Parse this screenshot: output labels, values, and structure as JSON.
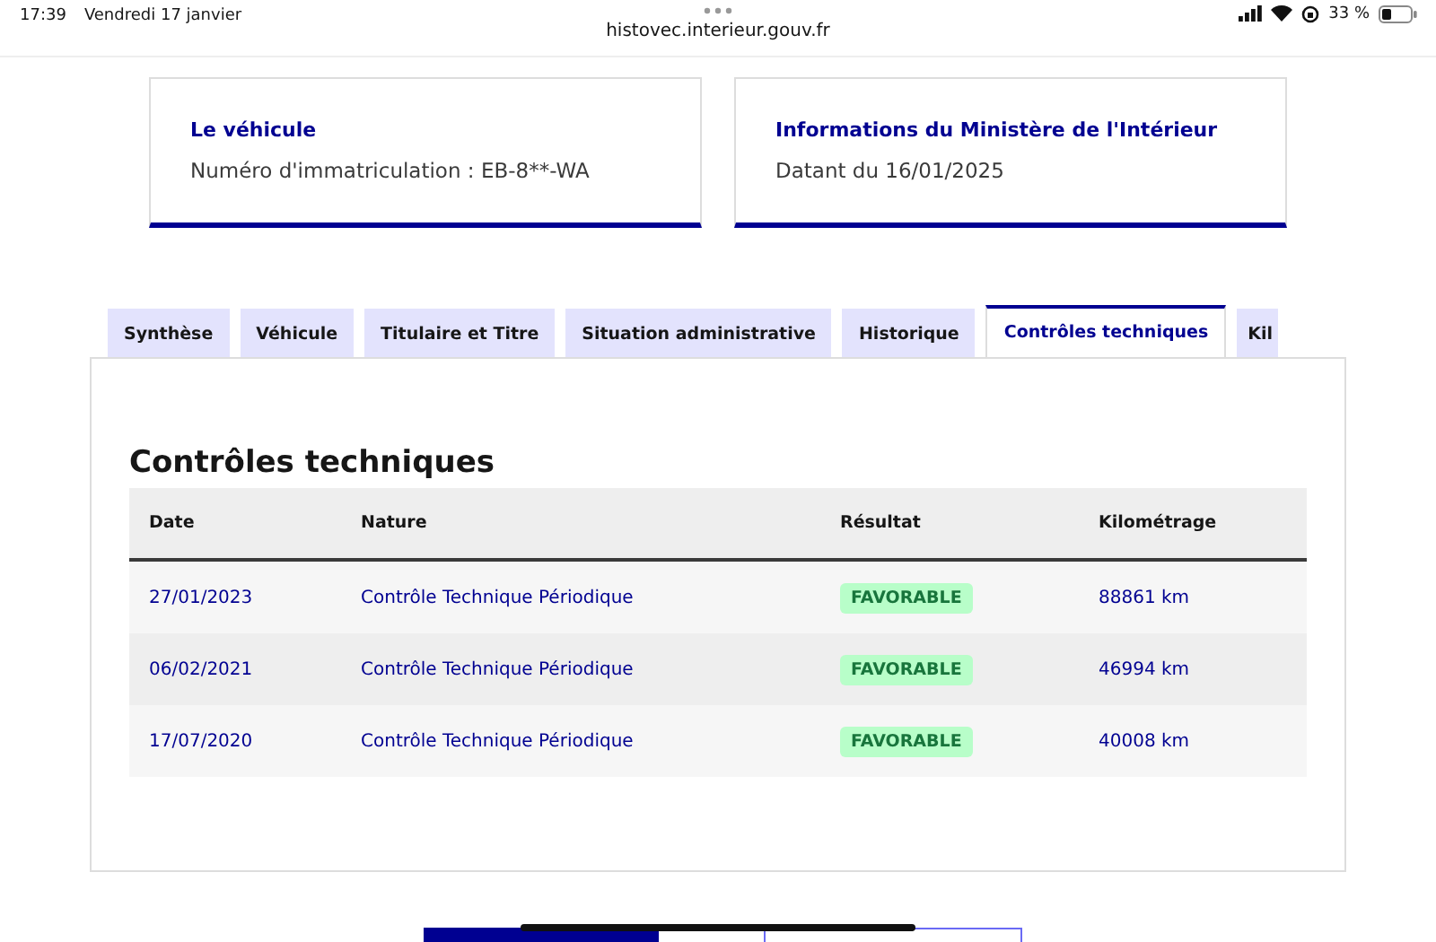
{
  "status_bar": {
    "time": "17:39",
    "date": "Vendredi 17 janvier",
    "url": "histovec.interieur.gouv.fr",
    "battery": "33 %"
  },
  "cards": [
    {
      "title": "Le véhicule",
      "text": "Numéro d'immatriculation : EB-8**-WA"
    },
    {
      "title": "Informations du Ministère de l'Intérieur",
      "text": "Datant du 16/01/2025"
    }
  ],
  "tabs": [
    {
      "label": "Synthèse",
      "selected": false
    },
    {
      "label": "Véhicule",
      "selected": false
    },
    {
      "label": "Titulaire et Titre",
      "selected": false
    },
    {
      "label": "Situation administrative",
      "selected": false
    },
    {
      "label": "Historique",
      "selected": false
    },
    {
      "label": "Contrôles techniques",
      "selected": true
    },
    {
      "label": "Kil",
      "selected": false
    }
  ],
  "section_title": "Contrôles techniques",
  "table": {
    "columns": [
      "Date",
      "Nature",
      "Résultat",
      "Kilométrage"
    ],
    "rows": [
      {
        "date": "27/01/2023",
        "nature": "Contrôle Technique Périodique",
        "result": "FAVORABLE",
        "mileage": "88861 km"
      },
      {
        "date": "06/02/2021",
        "nature": "Contrôle Technique Périodique",
        "result": "FAVORABLE",
        "mileage": "46994 km"
      },
      {
        "date": "17/07/2020",
        "nature": "Contrôle Technique Périodique",
        "result": "FAVORABLE",
        "mileage": "40008 km"
      }
    ]
  }
}
